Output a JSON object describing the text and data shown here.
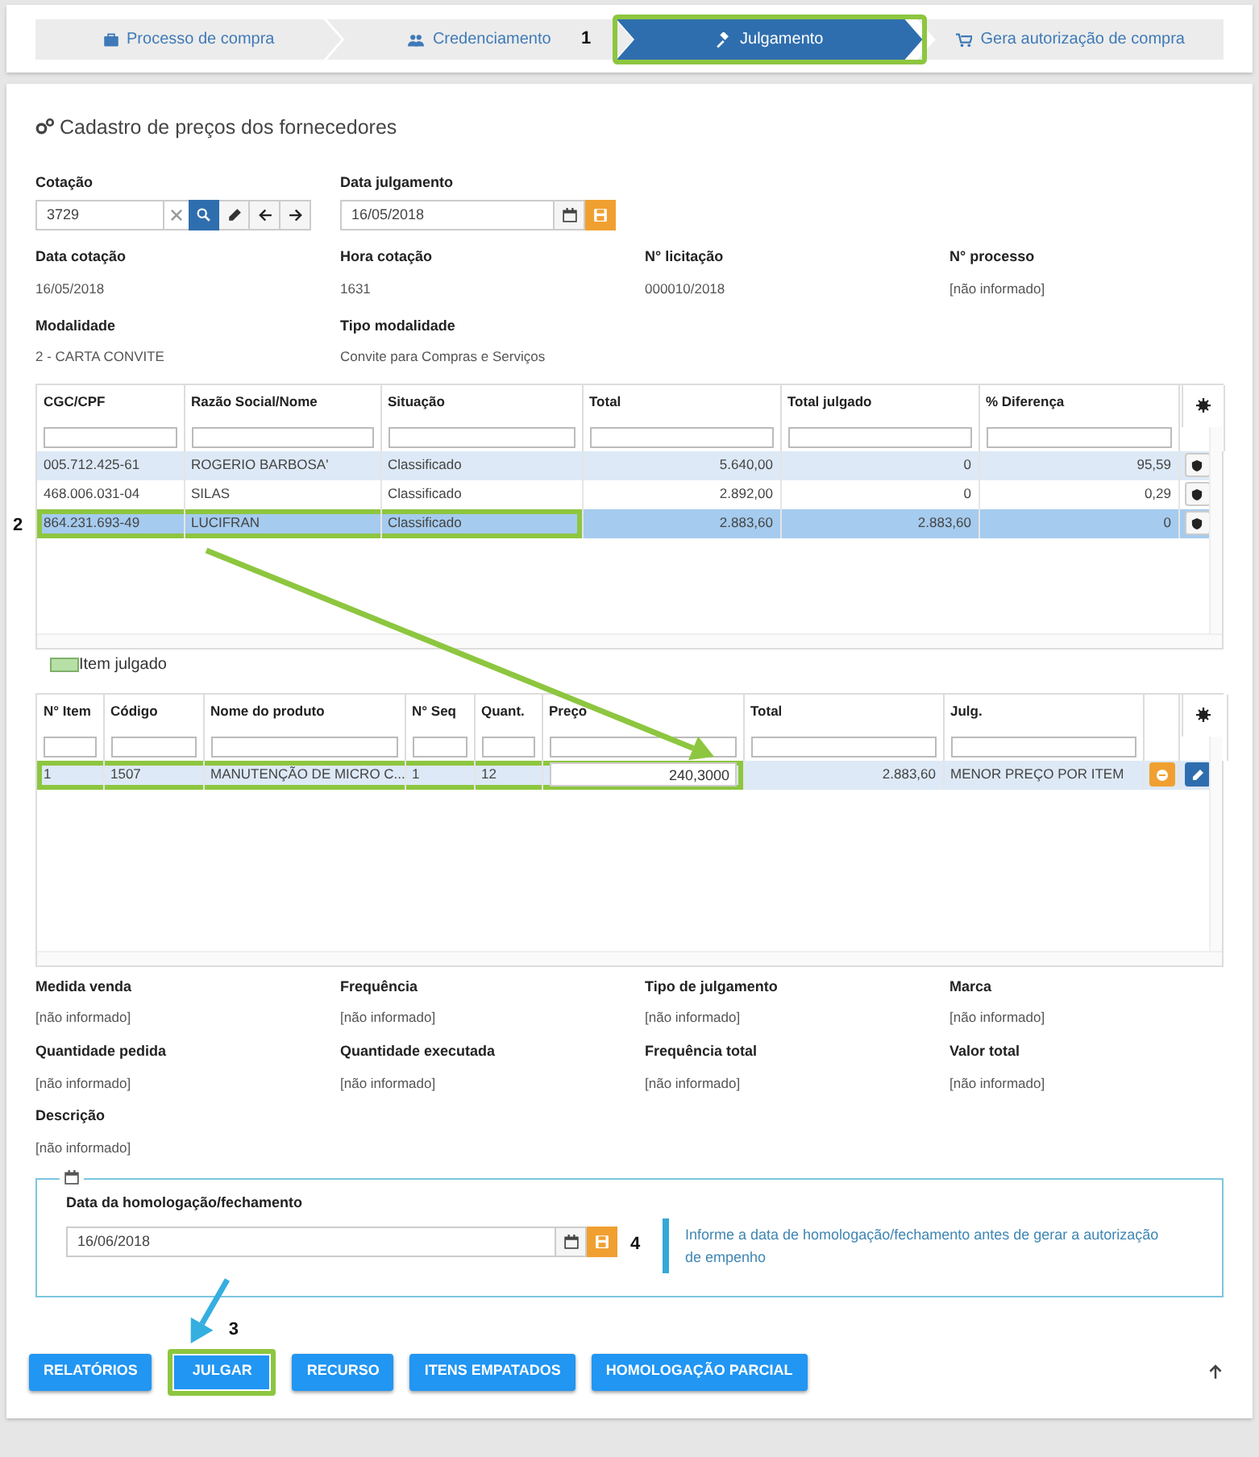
{
  "wizard": {
    "steps": [
      {
        "label": "Processo de compra",
        "selected": false,
        "highlighted": false
      },
      {
        "label": "Credenciamento",
        "selected": false,
        "highlighted": false
      },
      {
        "label": "Julgamento",
        "selected": true,
        "highlighted": true
      },
      {
        "label": "Gera autorização de compra",
        "selected": false,
        "highlighted": false
      }
    ]
  },
  "title": "Cadastro de preços dos fornecedores",
  "cotacao": {
    "label": "Cotação",
    "value": "3729"
  },
  "data_julgamento": {
    "label": "Data julgamento",
    "value": "16/05/2018"
  },
  "info_rows": [
    [
      {
        "label": "Data cotação",
        "value": "16/05/2018"
      },
      {
        "label": "Hora cotação",
        "value": "1631"
      },
      {
        "label": "N° licitação",
        "value": "000010/2018"
      },
      {
        "label": "N° processo",
        "value": "[não informado]"
      }
    ],
    [
      {
        "label": "Modalidade",
        "value": "2 - CARTA CONVITE"
      },
      {
        "label": "Tipo modalidade",
        "value": "Convite para Compras e Serviços"
      }
    ]
  ],
  "suppliers_table": {
    "columns": [
      "CGC/CPF",
      "Razão Social/Nome",
      "Situação",
      "Total",
      "Total julgado",
      "% Diferença"
    ],
    "rows": [
      {
        "selected": false,
        "marked": [
          false,
          false,
          false,
          false,
          false,
          false
        ],
        "cells": [
          "005.712.425-61",
          "ROGERIO BARBOSA'",
          "Classificado",
          "5.640,00",
          "0",
          "95,59"
        ]
      },
      {
        "selected": false,
        "marked": [
          false,
          false,
          false,
          false,
          false,
          false
        ],
        "cells": [
          "468.006.031-04",
          "SILAS",
          "Classificado",
          "2.892,00",
          "0",
          "0,29"
        ]
      },
      {
        "selected": true,
        "marked": [
          true,
          true,
          true,
          false,
          false,
          false
        ],
        "cells": [
          "864.231.693-49",
          "LUCIFRAN",
          "Classificado",
          "2.883,60",
          "2.883,60",
          "0"
        ]
      }
    ]
  },
  "legend": {
    "label": "Item julgado",
    "color": "#b6e0a6"
  },
  "items_table": {
    "columns": [
      "N° Item",
      "Código",
      "Nome do produto",
      "N° Seq",
      "Quant.",
      "Preço",
      "Total",
      "Julg."
    ],
    "rows": [
      {
        "selected": false,
        "marked": [
          true,
          true,
          true,
          true,
          true,
          true,
          false,
          false
        ],
        "cells": [
          "1",
          "1507",
          "MANUTENÇÃO DE MICRO C...",
          "1",
          "12",
          "240,3000",
          "2.883,60",
          "MENOR PREÇO POR ITEM"
        ]
      }
    ]
  },
  "detail_rows": [
    [
      {
        "label": "Medida venda",
        "value": "[não informado]"
      },
      {
        "label": "Frequência",
        "value": "[não informado]"
      },
      {
        "label": "Tipo de julgamento",
        "value": "[não informado]"
      },
      {
        "label": "Marca",
        "value": "[não informado]"
      }
    ],
    [
      {
        "label": "Quantidade pedida",
        "value": "[não informado]"
      },
      {
        "label": "Quantidade executada",
        "value": "[não informado]"
      },
      {
        "label": "Frequência total",
        "value": "[não informado]"
      },
      {
        "label": "Valor total",
        "value": "[não informado]"
      }
    ],
    [
      {
        "label": "Descrição",
        "value": "[não informado]"
      }
    ]
  ],
  "homologation": {
    "label": "Data da homologação/fechamento",
    "value": "16/06/2018",
    "note": "Informe a data de homologação/fechamento antes de gerar a autorização de empenho"
  },
  "buttons": [
    {
      "label": "RELATÓRIOS",
      "highlighted": false
    },
    {
      "label": "JULGAR",
      "highlighted": true
    },
    {
      "label": "RECURSO",
      "highlighted": false
    },
    {
      "label": "ITENS EMPATADOS",
      "highlighted": false
    },
    {
      "label": "HOMOLOGAÇÃO PARCIAL",
      "highlighted": false
    }
  ],
  "annotations": [
    {
      "number": "1"
    },
    {
      "number": "2"
    },
    {
      "number": "3"
    },
    {
      "number": "4"
    }
  ],
  "arrows": [
    {
      "color": "#8dc63f"
    },
    {
      "color": "#35aee0"
    }
  ]
}
